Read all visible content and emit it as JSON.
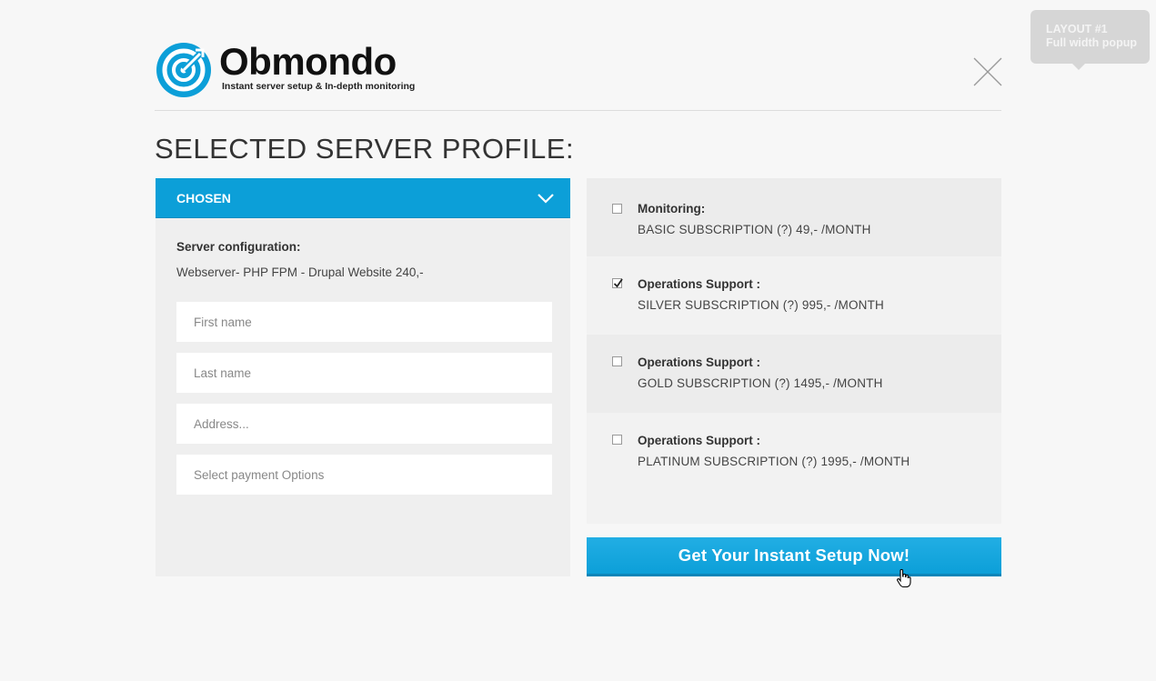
{
  "layout_tag": {
    "line1": "LAYOUT #1",
    "line2": "Full width popup"
  },
  "logo": {
    "name": "Obmondo",
    "tagline": "Instant server setup & In-depth monitoring",
    "brand_color": "#0c9fd8"
  },
  "page_title": "SELECTED SERVER PROFILE:",
  "left_panel": {
    "header": "CHOSEN",
    "server_config_label": "Server configuration:",
    "server_config_value": "Webserver- PHP FPM - Drupal Website 240,-",
    "fields": {
      "first_name": {
        "placeholder": "First name",
        "value": ""
      },
      "last_name": {
        "placeholder": "Last name",
        "value": ""
      },
      "address": {
        "placeholder": "Address...",
        "value": ""
      },
      "payment": {
        "placeholder": "Select payment Options",
        "value": ""
      }
    }
  },
  "options": [
    {
      "label": "Monitoring:",
      "value": "BASIC SUBSCRIPTION (?) 49,- /MONTH",
      "checked": false
    },
    {
      "label": "Operations Support :",
      "value": "SILVER SUBSCRIPTION (?) 995,- /MONTH",
      "checked": true
    },
    {
      "label": "Operations Support :",
      "value": "GOLD SUBSCRIPTION (?) 1495,- /MONTH",
      "checked": false
    },
    {
      "label": "Operations Support :",
      "value": "PLATINUM SUBSCRIPTION (?) 1995,- /MONTH",
      "checked": false
    }
  ],
  "cta_label": "Get Your Instant Setup Now!",
  "icons": {
    "close": "close-icon",
    "chevron": "chevron-down-icon",
    "check": "check-icon",
    "cursor": "hand-pointer-icon"
  }
}
